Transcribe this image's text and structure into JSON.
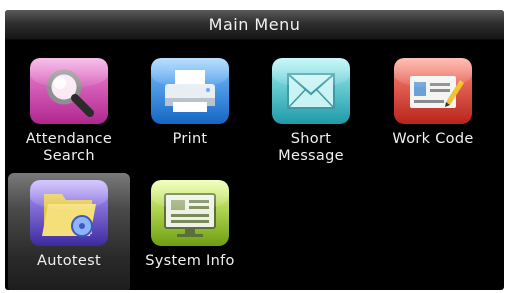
{
  "window": {
    "title": "Main Menu"
  },
  "menu": {
    "selected_index": 4,
    "items": [
      {
        "label_line1": "Attendance",
        "label_line2": "Search",
        "icon": "magnifier-search-icon",
        "color": "#d24bb5"
      },
      {
        "label_line1": "Print",
        "label_line2": "",
        "icon": "printer-icon",
        "color": "#2a8fe0"
      },
      {
        "label_line1": "Short",
        "label_line2": "Message",
        "icon": "envelope-icon",
        "color": "#3fc0c8"
      },
      {
        "label_line1": "Work Code",
        "label_line2": "",
        "icon": "id-card-pen-icon",
        "color": "#d8443a"
      },
      {
        "label_line1": "Autotest",
        "label_line2": "",
        "icon": "folder-autotest-icon",
        "color": "#6a4fc8"
      },
      {
        "label_line1": "System Info",
        "label_line2": "",
        "icon": "monitor-info-icon",
        "color": "#a3cc2a"
      }
    ]
  }
}
